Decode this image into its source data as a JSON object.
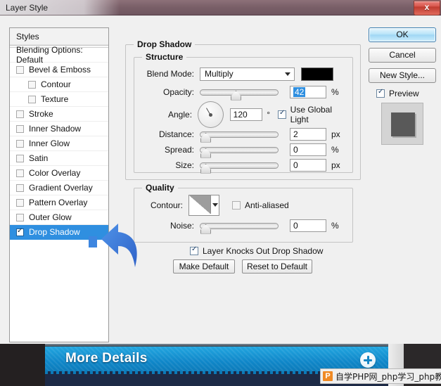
{
  "window": {
    "title": "Layer Style",
    "close_label": "x"
  },
  "styles_panel": {
    "header": "Styles",
    "items": [
      {
        "label": "Blending Options: Default",
        "has_checkbox": false,
        "checked": false,
        "indent": false,
        "selected": false
      },
      {
        "label": "Bevel & Emboss",
        "has_checkbox": true,
        "checked": false,
        "indent": false,
        "selected": false
      },
      {
        "label": "Contour",
        "has_checkbox": true,
        "checked": false,
        "indent": true,
        "selected": false
      },
      {
        "label": "Texture",
        "has_checkbox": true,
        "checked": false,
        "indent": true,
        "selected": false
      },
      {
        "label": "Stroke",
        "has_checkbox": true,
        "checked": false,
        "indent": false,
        "selected": false
      },
      {
        "label": "Inner Shadow",
        "has_checkbox": true,
        "checked": false,
        "indent": false,
        "selected": false
      },
      {
        "label": "Inner Glow",
        "has_checkbox": true,
        "checked": false,
        "indent": false,
        "selected": false
      },
      {
        "label": "Satin",
        "has_checkbox": true,
        "checked": false,
        "indent": false,
        "selected": false
      },
      {
        "label": "Color Overlay",
        "has_checkbox": true,
        "checked": false,
        "indent": false,
        "selected": false
      },
      {
        "label": "Gradient Overlay",
        "has_checkbox": true,
        "checked": false,
        "indent": false,
        "selected": false
      },
      {
        "label": "Pattern Overlay",
        "has_checkbox": true,
        "checked": false,
        "indent": false,
        "selected": false
      },
      {
        "label": "Outer Glow",
        "has_checkbox": true,
        "checked": false,
        "indent": false,
        "selected": false
      },
      {
        "label": "Drop Shadow",
        "has_checkbox": true,
        "checked": true,
        "indent": false,
        "selected": true
      }
    ]
  },
  "main": {
    "group_title": "Drop Shadow",
    "structure": {
      "legend": "Structure",
      "blend_mode_label": "Blend Mode:",
      "blend_mode_value": "Multiply",
      "shadow_color": "#000000",
      "opacity_label": "Opacity:",
      "opacity_value": "42",
      "opacity_unit": "%",
      "angle_label": "Angle:",
      "angle_value": "120",
      "angle_unit": "°",
      "use_global_light_label": "Use Global Light",
      "use_global_light_checked": true,
      "distance_label": "Distance:",
      "distance_value": "2",
      "distance_unit": "px",
      "spread_label": "Spread:",
      "spread_value": "0",
      "spread_unit": "%",
      "size_label": "Size:",
      "size_value": "0",
      "size_unit": "px"
    },
    "quality": {
      "legend": "Quality",
      "contour_label": "Contour:",
      "anti_aliased_label": "Anti-aliased",
      "anti_aliased_checked": false,
      "noise_label": "Noise:",
      "noise_value": "0",
      "noise_unit": "%"
    },
    "knockout_label": "Layer Knocks Out Drop Shadow",
    "knockout_checked": true,
    "make_default_label": "Make Default",
    "reset_default_label": "Reset to Default"
  },
  "buttons": {
    "ok": "OK",
    "cancel": "Cancel",
    "new_style": "New Style...",
    "preview_label": "Preview",
    "preview_checked": true
  },
  "banner": {
    "title": "More Details",
    "accent_color": "#0f86c8"
  },
  "watermark": {
    "logo": "P",
    "text": "自学PHP网_php学习_php教"
  }
}
